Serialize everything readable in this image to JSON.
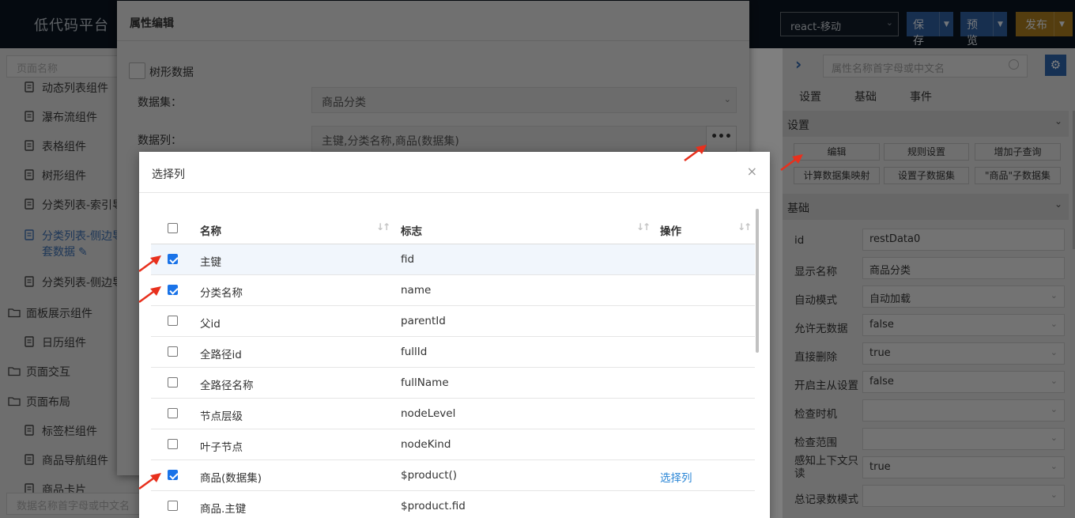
{
  "app": {
    "title": "低代码平台",
    "env_select": "react-移动",
    "save_label": "保存",
    "preview_label": "预览",
    "publish_label": "发布",
    "colors": {
      "topbar": "#0b1420",
      "primary": "#2f5f9e",
      "publish": "#a97b1f",
      "link": "#2b86d6",
      "checkbox": "#1a73e8",
      "annotation": "#e8301d"
    }
  },
  "left_panel": {
    "search_placeholder": "页面名称",
    "items": [
      {
        "label": "动态列表组件",
        "icon": "file-icon"
      },
      {
        "label": "瀑布流组件",
        "icon": "file-icon"
      },
      {
        "label": "表格组件",
        "icon": "file-icon"
      },
      {
        "label": "树形组件",
        "icon": "file-icon"
      },
      {
        "label": "分类列表-索引导",
        "icon": "file-icon"
      },
      {
        "label": "分类列表-侧边导",
        "label2": "套数据",
        "icon": "file-icon",
        "active": true
      },
      {
        "label": "分类列表-侧边导",
        "icon": "file-icon"
      },
      {
        "label": "面板展示组件",
        "icon": "folder-icon"
      },
      {
        "label": "日历组件",
        "icon": "file-icon"
      },
      {
        "label": "页面交互",
        "icon": "folder-icon"
      },
      {
        "label": "页面布局",
        "icon": "folder-icon"
      },
      {
        "label": "标签栏组件",
        "icon": "file-icon"
      },
      {
        "label": "商品导航组件",
        "icon": "file-icon"
      },
      {
        "label": "商品卡片",
        "icon": "file-icon"
      }
    ],
    "bottom_search_placeholder": "数据名称首字母或中文名"
  },
  "right_panel": {
    "search_placeholder": "属性名称首字母或中文名",
    "tabs": [
      "设置",
      "基础",
      "事件"
    ],
    "settings_section": "设置",
    "buttons": [
      "编辑",
      "规则设置",
      "增加子查询",
      "计算数据集映射",
      "设置子数据集",
      "\"商品\"子数据集"
    ],
    "basic_section": "基础",
    "props": [
      {
        "label": "id",
        "value": "restData0",
        "dropdown": false
      },
      {
        "label": "显示名称",
        "value": "商品分类",
        "dropdown": false
      },
      {
        "label": "自动模式",
        "value": "自动加载",
        "dropdown": true
      },
      {
        "label": "允许无数据",
        "value": "false",
        "dropdown": true
      },
      {
        "label": "直接删除",
        "value": "true",
        "dropdown": true
      },
      {
        "label": "开启主从设置",
        "value": "false",
        "dropdown": true
      },
      {
        "label": "检查时机",
        "value": "",
        "dropdown": true
      },
      {
        "label": "检查范围",
        "value": "",
        "dropdown": true
      },
      {
        "label": "感知上下文只",
        "label2": "读",
        "value": "true",
        "dropdown": true
      },
      {
        "label": "总记录数模式",
        "value": "",
        "dropdown": true
      }
    ]
  },
  "prop_dialog": {
    "title": "属性编辑",
    "tree_checkbox_label": "树形数据",
    "dataset_label": "数据集：",
    "dataset_value": "商品分类",
    "columns_label": "数据列：",
    "columns_value": "主键,分类名称,商品(数据集)",
    "more_label": "•••"
  },
  "column_dialog": {
    "title": "选择列",
    "close": "×",
    "headers": {
      "name": "名称",
      "flag": "标志",
      "op": "操作"
    },
    "rows": [
      {
        "name": "主键",
        "flag": "fid",
        "checked": true,
        "op": ""
      },
      {
        "name": "分类名称",
        "flag": "name",
        "checked": true,
        "op": ""
      },
      {
        "name": "父id",
        "flag": "parentId",
        "checked": false,
        "op": ""
      },
      {
        "name": "全路径id",
        "flag": "fullId",
        "checked": false,
        "op": ""
      },
      {
        "name": "全路径名称",
        "flag": "fullName",
        "checked": false,
        "op": ""
      },
      {
        "name": "节点层级",
        "flag": "nodeLevel",
        "checked": false,
        "op": ""
      },
      {
        "name": "叶子节点",
        "flag": "nodeKind",
        "checked": false,
        "op": ""
      },
      {
        "name": "商品(数据集)",
        "flag": "$product()",
        "checked": true,
        "op": "选择列"
      },
      {
        "name": "商品.主键",
        "flag": "$product.fid",
        "checked": false,
        "op": ""
      }
    ]
  }
}
